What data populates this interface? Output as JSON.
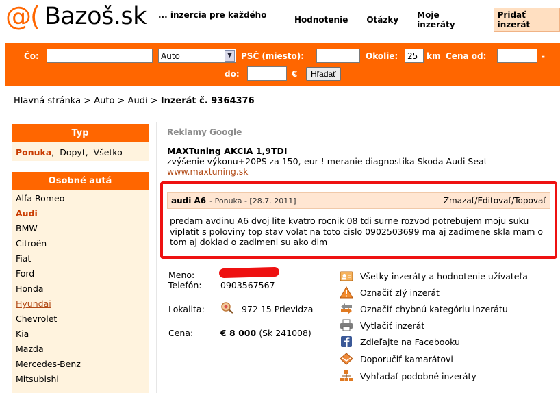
{
  "header": {
    "logo_mark": "@(",
    "logo_text": "Bazoš.sk",
    "slogan": "... inzercia pre každého",
    "nav": [
      "Hodnotenie",
      "Otázky",
      "Moje inzeráty"
    ],
    "post_button": "Pridať inzerát"
  },
  "search": {
    "co_label": "Čo:",
    "co_value": "",
    "category_selected": "Auto",
    "psc_label": "PSČ (miesto):",
    "psc_value": "",
    "okolie_label": "Okolie:",
    "okolie_value": "25",
    "km_label": "km",
    "cena_od_label": "Cena od:",
    "cena_od_value": "",
    "dash": "-",
    "do_label": "do:",
    "do_value": "",
    "currency": "€",
    "search_button": "Hľadať"
  },
  "breadcrumb": {
    "path": "Hlavná stránka > Auto > Audi > ",
    "current": "Inzerát č. 9364376"
  },
  "sidebar": {
    "typ_heading": "Typ",
    "typ_items": [
      "Ponuka",
      "Dopyt",
      "Všetko"
    ],
    "cars_heading": "Osobné autá",
    "cars": [
      "Alfa Romeo",
      "Audi",
      "BMW",
      "Citroën",
      "Fiat",
      "Ford",
      "Honda",
      "Hyundai",
      "Chevrolet",
      "Kia",
      "Mazda",
      "Mercedes-Benz",
      "Mitsubishi"
    ]
  },
  "ads": {
    "heading": "Reklamy Google",
    "title": "MAXTuning AKCIA 1,9TDI",
    "text": "zvýšenie výkonu+20PS za 150,-eur ! meranie diagnostika Skoda Audi Seat",
    "url": "www.maxtuning.sk"
  },
  "listing": {
    "title": "audi A6",
    "meta": "- Ponuka - [28.7. 2011]",
    "edit_link": "Zmazať/Editovať/Topovať",
    "body": "predam avdinu A6 dvoj lite kvatro rocnik 08 tdi surne rozvod potrebujem moju suku viplatit s poloviny top stav volat na toto cislo 0902503699 ma aj zadimene skla mam o tom aj doklad o zadimeni su ako dim"
  },
  "contact": {
    "name_label": "Meno:",
    "phone_label": "Telefón:",
    "phone_value": "0903567567",
    "location_label": "Lokalita:",
    "location_value": "972 15 Prievidza",
    "price_label": "Cena:",
    "price_value": "€ 8 000",
    "price_sk": "(Sk 241008)"
  },
  "actions": [
    {
      "label": "Všetky inzeráty a hodnotenie užívateľa",
      "icon": "user-card-icon"
    },
    {
      "label": "Označiť zlý inzerát",
      "icon": "warning-icon"
    },
    {
      "label": "Označiť chybnú kategóriu inzerátu",
      "icon": "swap-arrows-icon"
    },
    {
      "label": "Vytlačiť inzerát",
      "icon": "printer-icon"
    },
    {
      "label": "Zdieľajte na Facebooku",
      "icon": "facebook-icon"
    },
    {
      "label": "Doporučiť kamarátovi",
      "icon": "envelope-icon"
    },
    {
      "label": "Vyhľadať podobné inzeráty",
      "icon": "hierarchy-icon"
    }
  ],
  "colors": {
    "brand_orange": "#ff6600",
    "sidebar_bg": "#fff3de",
    "highlight_red": "#ee1111",
    "listing_head_bg": "#ffe6d2"
  }
}
